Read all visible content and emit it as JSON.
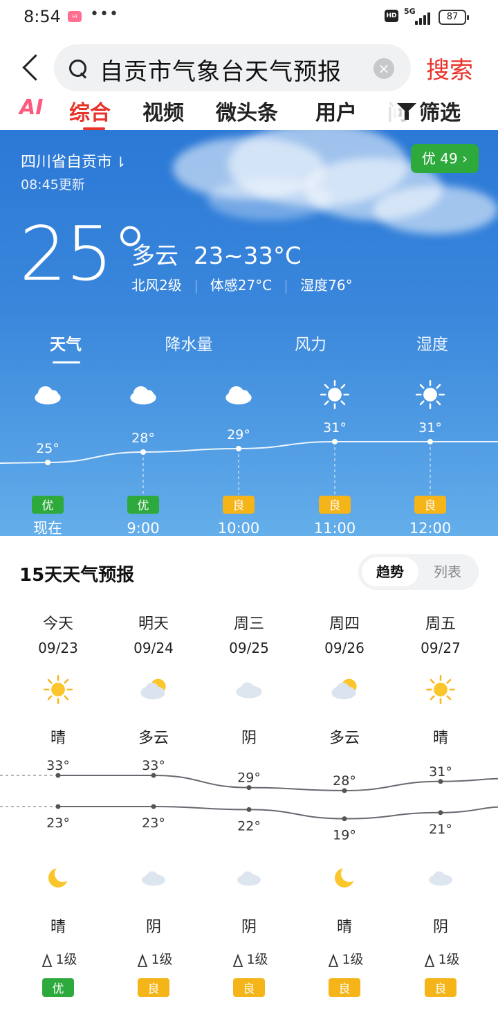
{
  "status_bar": {
    "time": "8:54",
    "app_badge": "Hi",
    "more": "•••",
    "hd": "HD",
    "network": "5G",
    "battery": "87"
  },
  "search": {
    "query": "自贡市气象台天气预报",
    "submit_label": "搜索",
    "clear_icon": "clear-icon"
  },
  "tabs": [
    {
      "label": "AI"
    },
    {
      "label": "综合"
    },
    {
      "label": "视频"
    },
    {
      "label": "微头条"
    },
    {
      "label": "用户"
    },
    {
      "label": "问"
    }
  ],
  "filter_label": "筛选",
  "current": {
    "location": "四川省自贡市",
    "location_arrow": "⇂",
    "updated": "08:45更新",
    "aqi_label": "优 49 ›",
    "temp": "25°",
    "condition": "多云",
    "range": "23~33°C",
    "wind": "北风2级",
    "feels_like": "体感27°C",
    "humidity": "湿度76°"
  },
  "hourly_tabs": [
    "天气",
    "降水量",
    "风力",
    "湿度"
  ],
  "hourly": [
    {
      "time": "现在",
      "temp": "25°",
      "value": 25,
      "icon": "cloudy-icon",
      "aqi": "优",
      "aqi_color": "#2eaa3c"
    },
    {
      "time": "9:00",
      "temp": "28°",
      "value": 28,
      "icon": "cloudy-icon",
      "aqi": "优",
      "aqi_color": "#2eaa3c"
    },
    {
      "time": "10:00",
      "temp": "29°",
      "value": 29,
      "icon": "cloudy-icon",
      "aqi": "良",
      "aqi_color": "#f5b417"
    },
    {
      "time": "11:00",
      "temp": "31°",
      "value": 31,
      "icon": "sun-icon",
      "aqi": "良",
      "aqi_color": "#f5b417"
    },
    {
      "time": "12:00",
      "temp": "31°",
      "value": 31,
      "icon": "sun-icon",
      "aqi": "良",
      "aqi_color": "#f5b417"
    }
  ],
  "forecast": {
    "title": "15天天气预报",
    "toggle": [
      "趋势",
      "列表"
    ],
    "days": [
      {
        "day": "今天",
        "date": "09/23",
        "day_icon": "sun-icon",
        "day_cond": "晴",
        "high": "33°",
        "high_v": 33,
        "low": "23°",
        "low_v": 23,
        "night_icon": "moon-icon",
        "night_cond": "晴",
        "wind": "1级",
        "aqi": "优",
        "aqi_color": "#2eaa3c"
      },
      {
        "day": "明天",
        "date": "09/24",
        "day_icon": "partly-cloudy-icon",
        "day_cond": "多云",
        "high": "33°",
        "high_v": 33,
        "low": "23°",
        "low_v": 23,
        "night_icon": "cloud-icon",
        "night_cond": "阴",
        "wind": "1级",
        "aqi": "良",
        "aqi_color": "#f5b417"
      },
      {
        "day": "周三",
        "date": "09/25",
        "day_icon": "cloud-icon",
        "day_cond": "阴",
        "high": "29°",
        "high_v": 29,
        "low": "22°",
        "low_v": 22,
        "night_icon": "cloud-icon",
        "night_cond": "阴",
        "wind": "1级",
        "aqi": "良",
        "aqi_color": "#f5b417"
      },
      {
        "day": "周四",
        "date": "09/26",
        "day_icon": "partly-cloudy-icon",
        "day_cond": "多云",
        "high": "28°",
        "high_v": 28,
        "low": "19°",
        "low_v": 19,
        "night_icon": "moon-icon",
        "night_cond": "晴",
        "wind": "1级",
        "aqi": "良",
        "aqi_color": "#f5b417"
      },
      {
        "day": "周五",
        "date": "09/27",
        "day_icon": "sun-icon",
        "day_cond": "晴",
        "high": "31°",
        "high_v": 31,
        "low": "21°",
        "low_v": 21,
        "night_icon": "cloud-icon",
        "night_cond": "阴",
        "wind": "1级",
        "aqi": "良",
        "aqi_color": "#f5b417"
      }
    ]
  }
}
